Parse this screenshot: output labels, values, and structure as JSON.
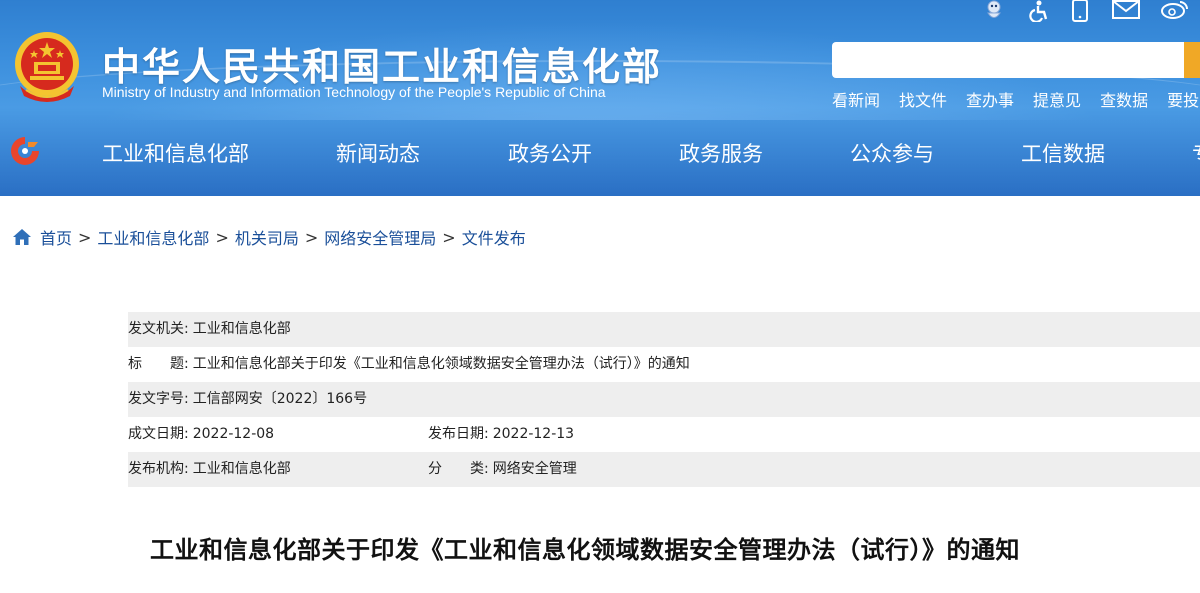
{
  "header": {
    "title_cn": "中华人民共和国工业和信息化部",
    "title_en": "Ministry of Industry and Information Technology of the People's Republic of China",
    "emblem_icon": "national-emblem-icon",
    "top_icons": [
      "mascot-icon",
      "accessibility-icon",
      "mobile-icon",
      "mail-icon",
      "weibo-icon"
    ],
    "search": {
      "placeholder": "",
      "value": ""
    },
    "quick_links": [
      "看新闻",
      "找文件",
      "查办事",
      "提意见",
      "查数据",
      "要投"
    ],
    "colors": {
      "banner": "#3c8fdd",
      "search_button": "#f0a826",
      "text": "#ffffff"
    }
  },
  "nav": {
    "logo_icon": "miit-logo-icon",
    "items": [
      "工业和信息化部",
      "新闻动态",
      "政务公开",
      "政务服务",
      "公众参与",
      "工信数据",
      "专"
    ]
  },
  "breadcrumb": {
    "home_icon": "home-icon",
    "items": [
      "首页",
      "工业和信息化部",
      "机关司局",
      "网络安全管理局",
      "文件发布"
    ],
    "separator": ">"
  },
  "info": {
    "issuer_label": "发文机关:",
    "issuer": "工业和信息化部",
    "title_label": "标　　题:",
    "title": "工业和信息化部关于印发《工业和信息化领域数据安全管理办法（试行）》的通知",
    "doc_no_label": "发文字号:",
    "doc_no": "工信部网安〔2022〕166号",
    "written_date_label": "成文日期:",
    "written_date": "2022-12-08",
    "publish_date_label": "发布日期:",
    "publish_date": "2022-12-13",
    "org_label": "发布机构:",
    "org": "工业和信息化部",
    "category_label": "分　　类:",
    "category": "网络安全管理"
  },
  "document": {
    "heading": "工业和信息化部关于印发《工业和信息化领域数据安全管理办法（试行）》的通知"
  }
}
